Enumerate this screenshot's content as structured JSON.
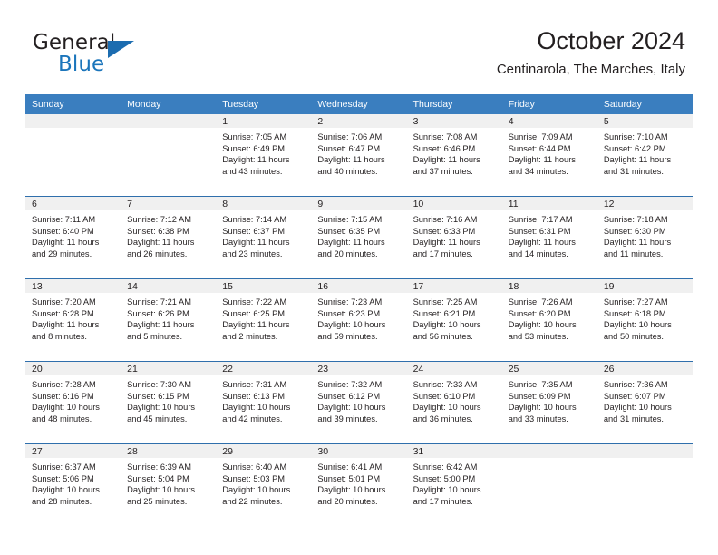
{
  "brand": {
    "name_part1": "General",
    "name_part2": "Blue",
    "logo_icon": "triangle-logo-icon"
  },
  "header": {
    "title": "October 2024",
    "subtitle": "Centinarola, The Marches, Italy"
  },
  "colors": {
    "header_blue": "#3a7ebf",
    "rule_blue": "#2f6fac",
    "daynum_band": "#f0f0f0",
    "brand_blue": "#1b75bb",
    "text": "#231f20"
  },
  "calendar": {
    "weekday_headers": [
      "Sunday",
      "Monday",
      "Tuesday",
      "Wednesday",
      "Thursday",
      "Friday",
      "Saturday"
    ],
    "labels": {
      "sunrise_prefix": "Sunrise:",
      "sunset_prefix": "Sunset:",
      "daylight_prefix": "Daylight:"
    },
    "weeks": [
      [
        {
          "day": "",
          "empty": true
        },
        {
          "day": "",
          "empty": true
        },
        {
          "day": "1",
          "sunrise": "Sunrise: 7:05 AM",
          "sunset": "Sunset: 6:49 PM",
          "daylight_line1": "Daylight: 11 hours",
          "daylight_line2": "and 43 minutes."
        },
        {
          "day": "2",
          "sunrise": "Sunrise: 7:06 AM",
          "sunset": "Sunset: 6:47 PM",
          "daylight_line1": "Daylight: 11 hours",
          "daylight_line2": "and 40 minutes."
        },
        {
          "day": "3",
          "sunrise": "Sunrise: 7:08 AM",
          "sunset": "Sunset: 6:46 PM",
          "daylight_line1": "Daylight: 11 hours",
          "daylight_line2": "and 37 minutes."
        },
        {
          "day": "4",
          "sunrise": "Sunrise: 7:09 AM",
          "sunset": "Sunset: 6:44 PM",
          "daylight_line1": "Daylight: 11 hours",
          "daylight_line2": "and 34 minutes."
        },
        {
          "day": "5",
          "sunrise": "Sunrise: 7:10 AM",
          "sunset": "Sunset: 6:42 PM",
          "daylight_line1": "Daylight: 11 hours",
          "daylight_line2": "and 31 minutes."
        }
      ],
      [
        {
          "day": "6",
          "sunrise": "Sunrise: 7:11 AM",
          "sunset": "Sunset: 6:40 PM",
          "daylight_line1": "Daylight: 11 hours",
          "daylight_line2": "and 29 minutes."
        },
        {
          "day": "7",
          "sunrise": "Sunrise: 7:12 AM",
          "sunset": "Sunset: 6:38 PM",
          "daylight_line1": "Daylight: 11 hours",
          "daylight_line2": "and 26 minutes."
        },
        {
          "day": "8",
          "sunrise": "Sunrise: 7:14 AM",
          "sunset": "Sunset: 6:37 PM",
          "daylight_line1": "Daylight: 11 hours",
          "daylight_line2": "and 23 minutes."
        },
        {
          "day": "9",
          "sunrise": "Sunrise: 7:15 AM",
          "sunset": "Sunset: 6:35 PM",
          "daylight_line1": "Daylight: 11 hours",
          "daylight_line2": "and 20 minutes."
        },
        {
          "day": "10",
          "sunrise": "Sunrise: 7:16 AM",
          "sunset": "Sunset: 6:33 PM",
          "daylight_line1": "Daylight: 11 hours",
          "daylight_line2": "and 17 minutes."
        },
        {
          "day": "11",
          "sunrise": "Sunrise: 7:17 AM",
          "sunset": "Sunset: 6:31 PM",
          "daylight_line1": "Daylight: 11 hours",
          "daylight_line2": "and 14 minutes."
        },
        {
          "day": "12",
          "sunrise": "Sunrise: 7:18 AM",
          "sunset": "Sunset: 6:30 PM",
          "daylight_line1": "Daylight: 11 hours",
          "daylight_line2": "and 11 minutes."
        }
      ],
      [
        {
          "day": "13",
          "sunrise": "Sunrise: 7:20 AM",
          "sunset": "Sunset: 6:28 PM",
          "daylight_line1": "Daylight: 11 hours",
          "daylight_line2": "and 8 minutes."
        },
        {
          "day": "14",
          "sunrise": "Sunrise: 7:21 AM",
          "sunset": "Sunset: 6:26 PM",
          "daylight_line1": "Daylight: 11 hours",
          "daylight_line2": "and 5 minutes."
        },
        {
          "day": "15",
          "sunrise": "Sunrise: 7:22 AM",
          "sunset": "Sunset: 6:25 PM",
          "daylight_line1": "Daylight: 11 hours",
          "daylight_line2": "and 2 minutes."
        },
        {
          "day": "16",
          "sunrise": "Sunrise: 7:23 AM",
          "sunset": "Sunset: 6:23 PM",
          "daylight_line1": "Daylight: 10 hours",
          "daylight_line2": "and 59 minutes."
        },
        {
          "day": "17",
          "sunrise": "Sunrise: 7:25 AM",
          "sunset": "Sunset: 6:21 PM",
          "daylight_line1": "Daylight: 10 hours",
          "daylight_line2": "and 56 minutes."
        },
        {
          "day": "18",
          "sunrise": "Sunrise: 7:26 AM",
          "sunset": "Sunset: 6:20 PM",
          "daylight_line1": "Daylight: 10 hours",
          "daylight_line2": "and 53 minutes."
        },
        {
          "day": "19",
          "sunrise": "Sunrise: 7:27 AM",
          "sunset": "Sunset: 6:18 PM",
          "daylight_line1": "Daylight: 10 hours",
          "daylight_line2": "and 50 minutes."
        }
      ],
      [
        {
          "day": "20",
          "sunrise": "Sunrise: 7:28 AM",
          "sunset": "Sunset: 6:16 PM",
          "daylight_line1": "Daylight: 10 hours",
          "daylight_line2": "and 48 minutes."
        },
        {
          "day": "21",
          "sunrise": "Sunrise: 7:30 AM",
          "sunset": "Sunset: 6:15 PM",
          "daylight_line1": "Daylight: 10 hours",
          "daylight_line2": "and 45 minutes."
        },
        {
          "day": "22",
          "sunrise": "Sunrise: 7:31 AM",
          "sunset": "Sunset: 6:13 PM",
          "daylight_line1": "Daylight: 10 hours",
          "daylight_line2": "and 42 minutes."
        },
        {
          "day": "23",
          "sunrise": "Sunrise: 7:32 AM",
          "sunset": "Sunset: 6:12 PM",
          "daylight_line1": "Daylight: 10 hours",
          "daylight_line2": "and 39 minutes."
        },
        {
          "day": "24",
          "sunrise": "Sunrise: 7:33 AM",
          "sunset": "Sunset: 6:10 PM",
          "daylight_line1": "Daylight: 10 hours",
          "daylight_line2": "and 36 minutes."
        },
        {
          "day": "25",
          "sunrise": "Sunrise: 7:35 AM",
          "sunset": "Sunset: 6:09 PM",
          "daylight_line1": "Daylight: 10 hours",
          "daylight_line2": "and 33 minutes."
        },
        {
          "day": "26",
          "sunrise": "Sunrise: 7:36 AM",
          "sunset": "Sunset: 6:07 PM",
          "daylight_line1": "Daylight: 10 hours",
          "daylight_line2": "and 31 minutes."
        }
      ],
      [
        {
          "day": "27",
          "sunrise": "Sunrise: 6:37 AM",
          "sunset": "Sunset: 5:06 PM",
          "daylight_line1": "Daylight: 10 hours",
          "daylight_line2": "and 28 minutes."
        },
        {
          "day": "28",
          "sunrise": "Sunrise: 6:39 AM",
          "sunset": "Sunset: 5:04 PM",
          "daylight_line1": "Daylight: 10 hours",
          "daylight_line2": "and 25 minutes."
        },
        {
          "day": "29",
          "sunrise": "Sunrise: 6:40 AM",
          "sunset": "Sunset: 5:03 PM",
          "daylight_line1": "Daylight: 10 hours",
          "daylight_line2": "and 22 minutes."
        },
        {
          "day": "30",
          "sunrise": "Sunrise: 6:41 AM",
          "sunset": "Sunset: 5:01 PM",
          "daylight_line1": "Daylight: 10 hours",
          "daylight_line2": "and 20 minutes."
        },
        {
          "day": "31",
          "sunrise": "Sunrise: 6:42 AM",
          "sunset": "Sunset: 5:00 PM",
          "daylight_line1": "Daylight: 10 hours",
          "daylight_line2": "and 17 minutes."
        },
        {
          "day": "",
          "empty": true
        },
        {
          "day": "",
          "empty": true
        }
      ]
    ]
  }
}
